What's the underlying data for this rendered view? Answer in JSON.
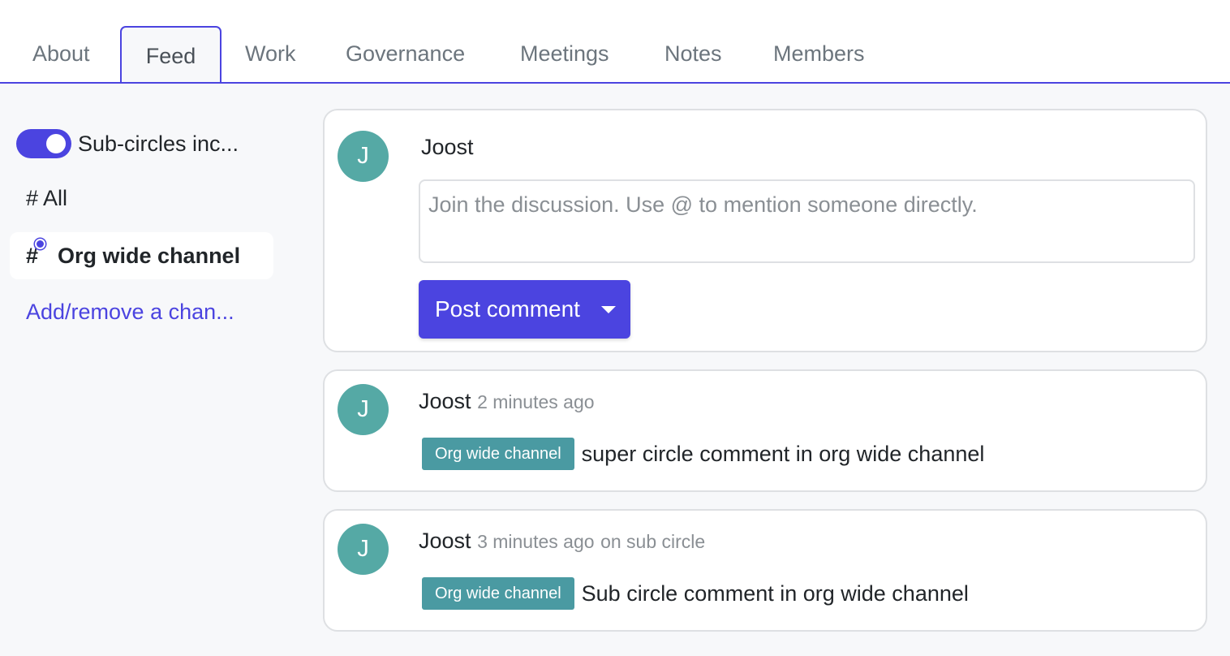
{
  "tabs": [
    {
      "label": "About",
      "active": false
    },
    {
      "label": "Feed",
      "active": true
    },
    {
      "label": "Work",
      "active": false
    },
    {
      "label": "Governance",
      "active": false
    },
    {
      "label": "Meetings",
      "active": false
    },
    {
      "label": "Notes",
      "active": false
    },
    {
      "label": "Members",
      "active": false
    }
  ],
  "sidebar": {
    "toggle": {
      "label": "Sub-circles inc...",
      "on": true
    },
    "channels": [
      {
        "hash": "#",
        "label": "All",
        "selected": false
      },
      {
        "hash": "#",
        "label": "Org wide channel",
        "selected": true,
        "unread_dot": true
      }
    ],
    "add_link": "Add/remove a chan..."
  },
  "composer": {
    "avatar_initial": "J",
    "author": "Joost",
    "placeholder": "Join the discussion. Use @ to mention someone directly.",
    "post_label": "Post comment"
  },
  "comments": [
    {
      "avatar_initial": "J",
      "author": "Joost",
      "time": "2 minutes ago",
      "where": "",
      "channel_badge": "Org wide channel",
      "text": "super circle comment in org wide channel"
    },
    {
      "avatar_initial": "J",
      "author": "Joost",
      "time": "3 minutes ago",
      "where": "on sub circle",
      "channel_badge": "Org wide channel",
      "text": "Sub circle comment in org wide channel"
    }
  ],
  "colors": {
    "accent": "#4b44e0",
    "avatar": "#55a9a5",
    "badge": "#4a9aa2",
    "muted_text": "#8a8f94"
  }
}
